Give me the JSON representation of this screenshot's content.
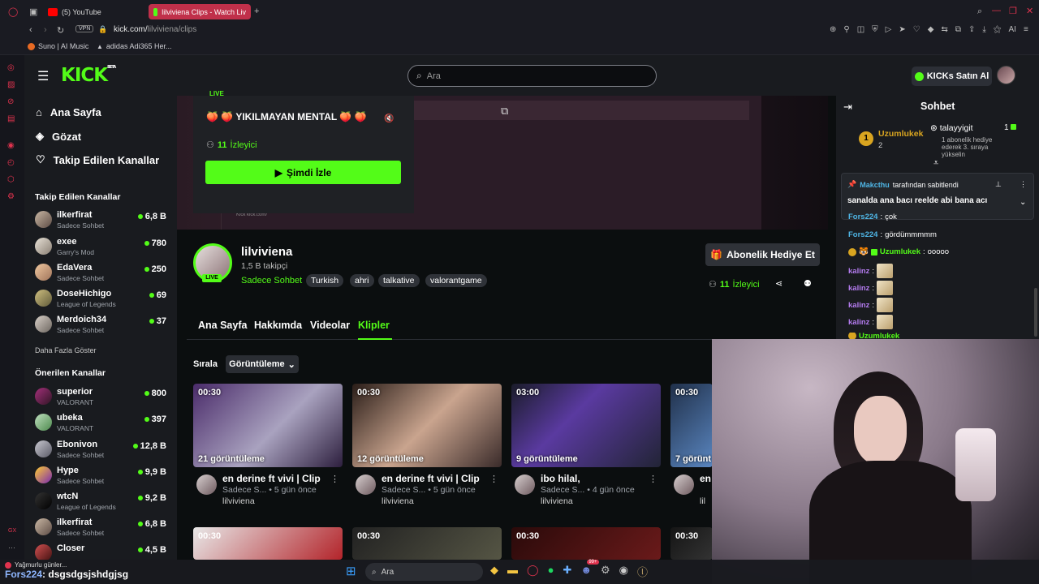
{
  "browser": {
    "tabs": [
      {
        "label": "(5) YouTube"
      },
      {
        "label": "lilviviena Clips - Watch Liv"
      }
    ],
    "vpn_label": "VPN",
    "url_host": "kick.com/",
    "url_path": "lilviviena/clips",
    "ai_label": "AI",
    "bookmarks": [
      {
        "label": "Suno | AI Music"
      },
      {
        "label": "adidas Adi365 Her..."
      }
    ]
  },
  "header": {
    "logo": "KICK",
    "logo_sup": "BETA",
    "search_placeholder": "Ara",
    "kicks_button": "KICKs Satın Al"
  },
  "sidebar": {
    "main_items": [
      {
        "label": "Ana Sayfa"
      },
      {
        "label": "Gözat"
      },
      {
        "label": "Takip Edilen Kanallar"
      }
    ],
    "following_title": "Takip Edilen Kanallar",
    "following": [
      {
        "name": "ilkerfirat",
        "category": "Sadece Sohbet",
        "viewers": "6,8 B"
      },
      {
        "name": "exee",
        "category": "Garry's Mod",
        "viewers": "780"
      },
      {
        "name": "EdaVera",
        "category": "Sadece Sohbet",
        "viewers": "250"
      },
      {
        "name": "DoseHichigo",
        "category": "League of Legends",
        "viewers": "69"
      },
      {
        "name": "Merdoich34",
        "category": "Sadece Sohbet",
        "viewers": "37"
      }
    ],
    "show_more": "Daha Fazla Göster",
    "recommended_title": "Önerilen Kanallar",
    "recommended": [
      {
        "name": "superior",
        "category": "VALORANT",
        "viewers": "800"
      },
      {
        "name": "ubeka",
        "category": "VALORANT",
        "viewers": "397"
      },
      {
        "name": "Ebonivon",
        "category": "Sadece Sohbet",
        "viewers": "12,8 B"
      },
      {
        "name": "Hype",
        "category": "Sadece Sohbet",
        "viewers": "9,9 B"
      },
      {
        "name": "wtcN",
        "category": "League of Legends",
        "viewers": "9,2 B"
      },
      {
        "name": "ilkerfirat",
        "category": "Sadece Sohbet",
        "viewers": "6,8 B"
      },
      {
        "name": "Closer",
        "category": "",
        "viewers": "4,5 B"
      }
    ]
  },
  "player": {
    "live_label": "LIVE",
    "stream_title": "🍑 🍑 YIKILMAYAN MENTAL 🍑 🍑",
    "viewers_count": "11",
    "viewers_label": "İzleyici",
    "watch_button": "Şimdi İzle",
    "bg_text_url": "kick.com/",
    "bg_text_kick": "Kick"
  },
  "channel": {
    "name": "lilviviena",
    "followers": "1,5 B takipçi",
    "category": "Sadece Sohbet",
    "live_badge": "LIVE",
    "tags": [
      "Turkish",
      "ahri",
      "talkative",
      "valorantgame"
    ],
    "gift_button": "Abonelik Hediye Et",
    "viewers_count": "11",
    "viewers_label": "İzleyici"
  },
  "tabs": [
    {
      "label": "Ana Sayfa"
    },
    {
      "label": "Hakkımda"
    },
    {
      "label": "Videolar"
    },
    {
      "label": "Klipler"
    }
  ],
  "sort": {
    "label": "Sırala",
    "value": "Görüntüleme"
  },
  "clips": [
    {
      "duration": "00:30",
      "views": "21 görüntüleme",
      "title": "en derine ft vivi | Clip",
      "category": "Sadece S...",
      "age": "5 gün önce",
      "channel": "lilviviena"
    },
    {
      "duration": "00:30",
      "views": "12 görüntüleme",
      "title": "en derine ft vivi | Clip",
      "category": "Sadece S...",
      "age": "5 gün önce",
      "channel": "lilviviena"
    },
    {
      "duration": "03:00",
      "views": "9 görüntüleme",
      "title": "ibo hilal,",
      "category": "Sadece S...",
      "age": "4 gün önce",
      "channel": "lilviviena"
    },
    {
      "duration": "00:30",
      "views": "7 görünt",
      "title": "en",
      "category": "",
      "age": "",
      "channel": "lil"
    }
  ],
  "clips_row2": [
    {
      "duration": "00:30"
    },
    {
      "duration": "00:30"
    },
    {
      "duration": "00:30"
    },
    {
      "duration": "00:30"
    }
  ],
  "chat": {
    "title": "Sohbet",
    "leaderboard": {
      "first_name": "Uzumlukek",
      "first_rank": "1",
      "first_count": "2",
      "second_name": "talayyigit",
      "second_count": "1",
      "second_note": "1 abonelik hediye ederek 3. sıraya yükselin"
    },
    "pinned_by_user": "Makcthu",
    "pinned_by_text": "tarafından sabitlendi",
    "pinned_message": "sanalda ana bacı reelde abi bana acı",
    "messages": [
      {
        "user": "Fors224",
        "text": "çok"
      },
      {
        "user": "Fors224",
        "text": "gördümmmmm"
      },
      {
        "user": "Uzumlukek",
        "text": "ooooo"
      },
      {
        "user": "kalinz",
        "text": ""
      },
      {
        "user": "kalinz",
        "text": ""
      },
      {
        "user": "kalinz",
        "text": ""
      },
      {
        "user": "kalinz",
        "text": ""
      },
      {
        "user": "Uzumlukek",
        "text": ""
      }
    ]
  },
  "overlay": {
    "chat_user": "Fors224",
    "chat_text": ": dsgsdgsjshdgjsg",
    "notify_text": "Yağmurlu günler...",
    "gx_label": "GX"
  },
  "taskbar": {
    "search_placeholder": "Ara",
    "badge": "99+"
  },
  "colors": {
    "accent": "#53fc18",
    "bg": "#0b0e0f",
    "panel": "#191b1f"
  }
}
